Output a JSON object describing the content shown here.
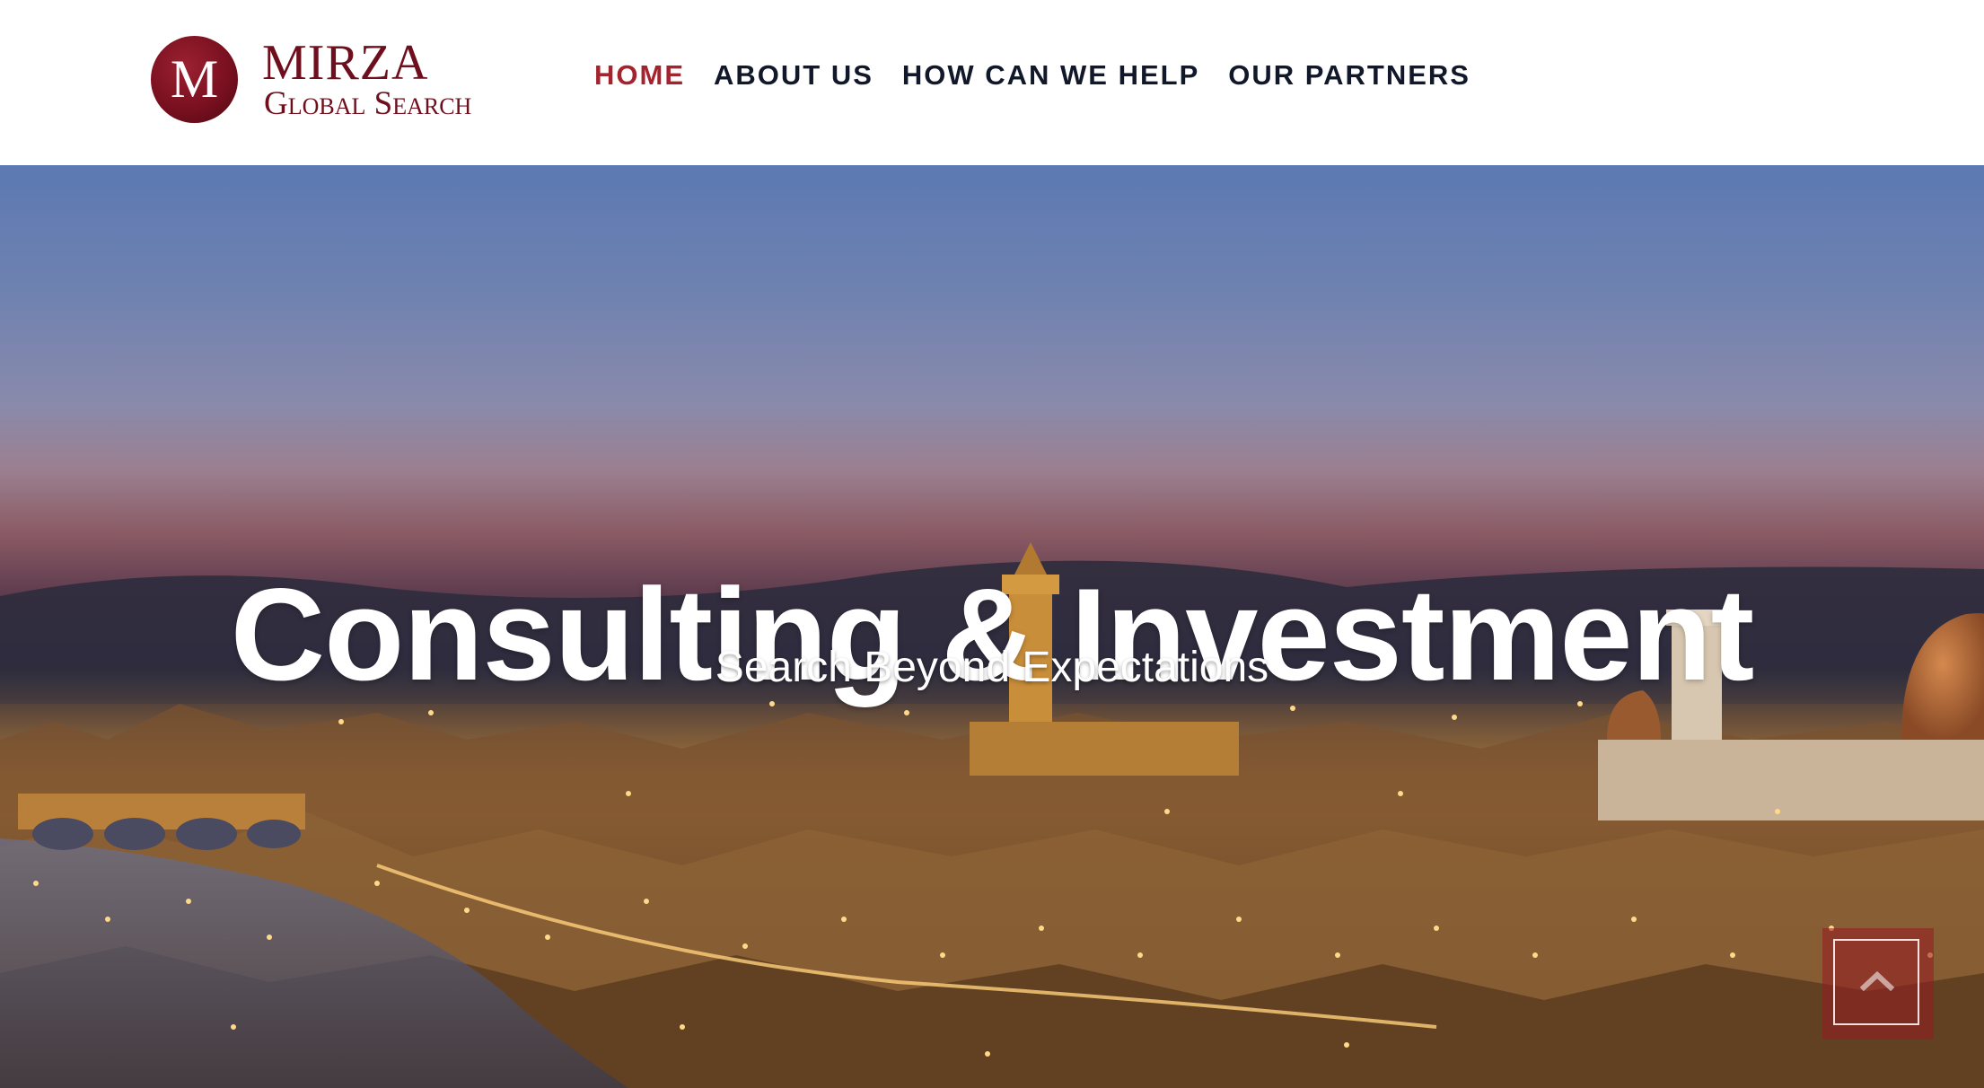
{
  "brand": {
    "logo_letter": "M",
    "name": "MIRZA",
    "tagline": "Global Search",
    "color": "#6d0f1d"
  },
  "nav": {
    "items": [
      {
        "label": "HOME",
        "active": true
      },
      {
        "label": "ABOUT US",
        "active": false
      },
      {
        "label": "HOW CAN WE HELP",
        "active": false
      },
      {
        "label": "OUR PARTNERS",
        "active": false
      }
    ],
    "active_color": "#a3232e",
    "text_color": "#10182a"
  },
  "hero": {
    "title": "Consulting & Investment",
    "subtitle": "Search Beyond Expectations",
    "background": "night-cityscape-image"
  },
  "scroll_top": {
    "icon": "chevron-up-icon"
  }
}
